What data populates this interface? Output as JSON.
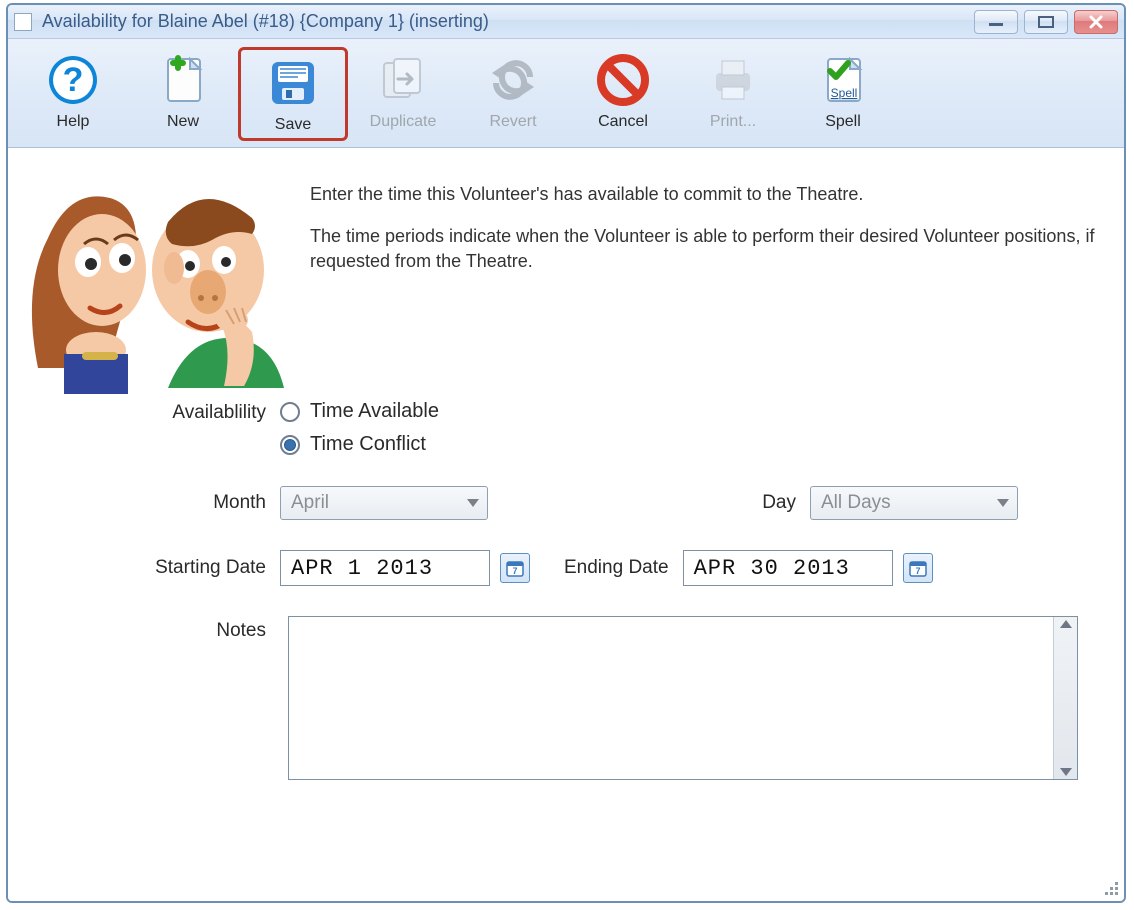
{
  "window": {
    "title": "Availability for Blaine Abel (#18) {Company 1} (inserting)"
  },
  "toolbar": {
    "help": {
      "label": "Help",
      "icon": "help-icon",
      "enabled": true
    },
    "new": {
      "label": "New",
      "icon": "new-icon",
      "enabled": true
    },
    "save": {
      "label": "Save",
      "icon": "save-icon",
      "enabled": true,
      "highlighted": true
    },
    "duplicate": {
      "label": "Duplicate",
      "icon": "duplicate-icon",
      "enabled": false
    },
    "revert": {
      "label": "Revert",
      "icon": "revert-icon",
      "enabled": false
    },
    "cancel": {
      "label": "Cancel",
      "icon": "cancel-icon",
      "enabled": true
    },
    "print": {
      "label": "Print...",
      "icon": "print-icon",
      "enabled": false
    },
    "spell": {
      "label": "Spell",
      "icon": "spell-icon",
      "enabled": true
    }
  },
  "intro": {
    "line1": "Enter the time this Volunteer's has available to commit to the Theatre.",
    "line2": "The time periods indicate when the Volunteer is able to perform their desired Volunteer positions, if requested from the Theatre."
  },
  "form": {
    "availability": {
      "label": "Availablility",
      "option_available": "Time Available",
      "option_conflict": "Time Conflict",
      "selected": "conflict"
    },
    "month": {
      "label": "Month",
      "value": "April"
    },
    "day": {
      "label": "Day",
      "value": "All Days"
    },
    "start": {
      "label": "Starting Date",
      "value": "APR 1 2013"
    },
    "end": {
      "label": "Ending Date",
      "value": "APR 30 2013"
    },
    "notes": {
      "label": "Notes",
      "value": ""
    }
  }
}
